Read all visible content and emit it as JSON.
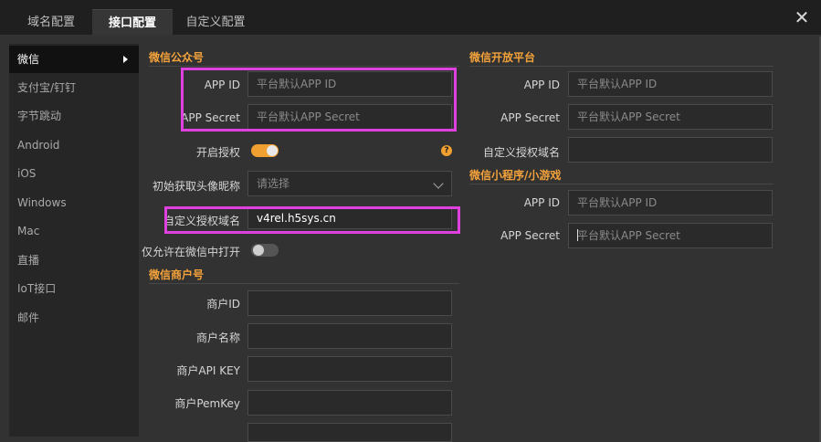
{
  "tabs": [
    {
      "label": "域名配置"
    },
    {
      "label": "接口配置"
    },
    {
      "label": "自定义配置"
    }
  ],
  "close_glyph": "✕",
  "sidebar": {
    "items": [
      {
        "label": "微信"
      },
      {
        "label": "支付宝/钉钉"
      },
      {
        "label": "字节跳动"
      },
      {
        "label": "Android"
      },
      {
        "label": "iOS"
      },
      {
        "label": "Windows"
      },
      {
        "label": "Mac"
      },
      {
        "label": "直播"
      },
      {
        "label": "IoT接口"
      },
      {
        "label": "邮件"
      }
    ]
  },
  "wechat_mp": {
    "title": "微信公众号",
    "app_id_label": "APP ID",
    "app_id_placeholder": "平台默认APP ID",
    "app_secret_label": "APP Secret",
    "app_secret_placeholder": "平台默认APP Secret",
    "auth_label": "开启授权",
    "auth_enabled": true,
    "help_glyph": "?",
    "initial_fetch_label": "初始获取头像昵称",
    "initial_fetch_placeholder": "请选择",
    "custom_domain_label": "自定义授权域名",
    "custom_domain_value": "v4rel.h5sys.cn",
    "wechat_only_label": "仅允许在微信中打开",
    "wechat_only_enabled": false
  },
  "wechat_merchant": {
    "title": "微信商户号",
    "merchant_id_label": "商户ID",
    "merchant_name_label": "商户名称",
    "api_key_label": "商户API KEY",
    "pem_key_label": "商户PemKey"
  },
  "wechat_open": {
    "title": "微信开放平台",
    "app_id_label": "APP ID",
    "app_id_placeholder": "平台默认APP ID",
    "app_secret_label": "APP Secret",
    "app_secret_placeholder": "平台默认APP Secret",
    "custom_domain_label": "自定义授权域名"
  },
  "wechat_mini": {
    "title": "微信小程序/小游戏",
    "app_id_label": "APP ID",
    "app_id_placeholder": "平台默认APP ID",
    "app_secret_label": "APP Secret",
    "app_secret_placeholder": "平台默认APP Secret"
  },
  "colors": {
    "accent": "#f4a23a",
    "highlight": "#e040e0"
  }
}
